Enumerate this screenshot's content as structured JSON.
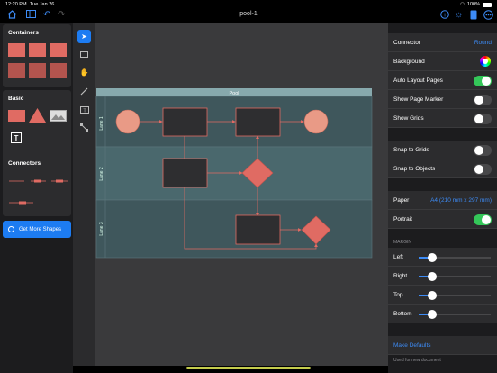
{
  "status": {
    "time": "12:20 PM",
    "date": "Tue Jan 26",
    "battery": "100%"
  },
  "toolbar": {
    "title": "pool-1"
  },
  "sidebar": {
    "containers_title": "Containers",
    "basic_title": "Basic",
    "connectors_title": "Connectors",
    "more_label": "Get More Shapes"
  },
  "diagram": {
    "pool_label": "Pool",
    "lanes": [
      "Lane 1",
      "Lane 2",
      "Lane 3"
    ]
  },
  "settings": {
    "connector_label": "Connector",
    "connector_value": "Round",
    "background_label": "Background",
    "auto_layout_label": "Auto Layout Pages",
    "auto_layout_on": true,
    "page_marker_label": "Show Page Marker",
    "page_marker_on": false,
    "grids_label": "Show Grids",
    "grids_on": false,
    "snap_grids_label": "Snap to Grids",
    "snap_grids_on": false,
    "snap_objects_label": "Snap to Objects",
    "snap_objects_on": false,
    "paper_label": "Paper",
    "paper_value": "A4 (210 mm x 297 mm)",
    "portrait_label": "Portrait",
    "portrait_on": true,
    "margin_header": "MARGIN",
    "margin_left": "Left",
    "margin_right": "Right",
    "margin_top": "Top",
    "margin_bottom": "Bottom",
    "make_defaults": "Make Defaults",
    "defaults_note": "Used for new document"
  },
  "colors": {
    "accent": "#1d7cf2",
    "shape_fill": "#e06b63",
    "lane_bg": "#3f5a60"
  }
}
